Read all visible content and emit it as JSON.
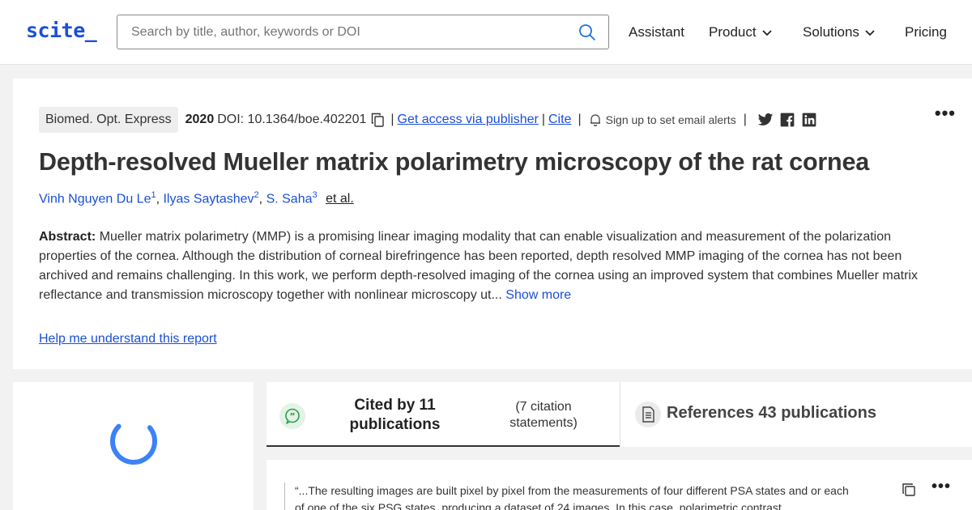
{
  "header": {
    "logo": "scite_",
    "search": {
      "placeholder": "Search by title, author, keywords or DOI",
      "value": "",
      "icon": "search-icon"
    },
    "nav": {
      "assistant": "Assistant",
      "product": "Product",
      "solutions": "Solutions",
      "pricing": "Pricing"
    }
  },
  "article": {
    "journal": "Biomed. Opt. Express",
    "year": "2020",
    "doi": "DOI: 10.1364/boe.402201",
    "get_access": "Get access via publisher",
    "cite": "Cite",
    "alerts": "Sign up to set email alerts",
    "social": [
      "twitter-icon",
      "facebook-icon",
      "linkedin-icon"
    ],
    "title": "Depth-resolved Mueller matrix polarimetry microscopy of the rat cornea",
    "authors": [
      {
        "name": "Vinh Nguyen Du Le",
        "sup": "1"
      },
      {
        "name": "Ilyas Saytashev",
        "sup": "2"
      },
      {
        "name": "S. Saha",
        "sup": "3"
      }
    ],
    "etal": "et al.",
    "abstract_label": "Abstract:",
    "abstract_text": "Mueller matrix polarimetry (MMP) is a promising linear imaging modality that can enable visualization and measurement of the polarization properties of the cornea. Although the distribution of corneal birefringence has been reported, depth resolved MMP imaging of the cornea has not been archived and remains challenging. In this work, we perform depth-resolved imaging of the cornea using an improved system that combines Mueller matrix reflectance and transmission microscopy together with nonlinear microscopy ut...",
    "show_more": "Show more",
    "help_link": "Help me understand this report"
  },
  "tabs": {
    "cited_label": "Cited by 11 publications",
    "cited_sub": "(7 citation statements)",
    "references_label": "References 43 publications"
  },
  "statement": {
    "text": "“...The resulting images are built pixel by pixel from the measurements of four different PSA states and or each of one of the six PSG states, producing a dataset of 24 images. In this case, polarimetric contrast..."
  },
  "colors": {
    "accent": "#1a4fd8",
    "spinner": "#3b82f6",
    "quote_badge": "#e3f3e6",
    "quote_icon": "#2e9e4a"
  }
}
